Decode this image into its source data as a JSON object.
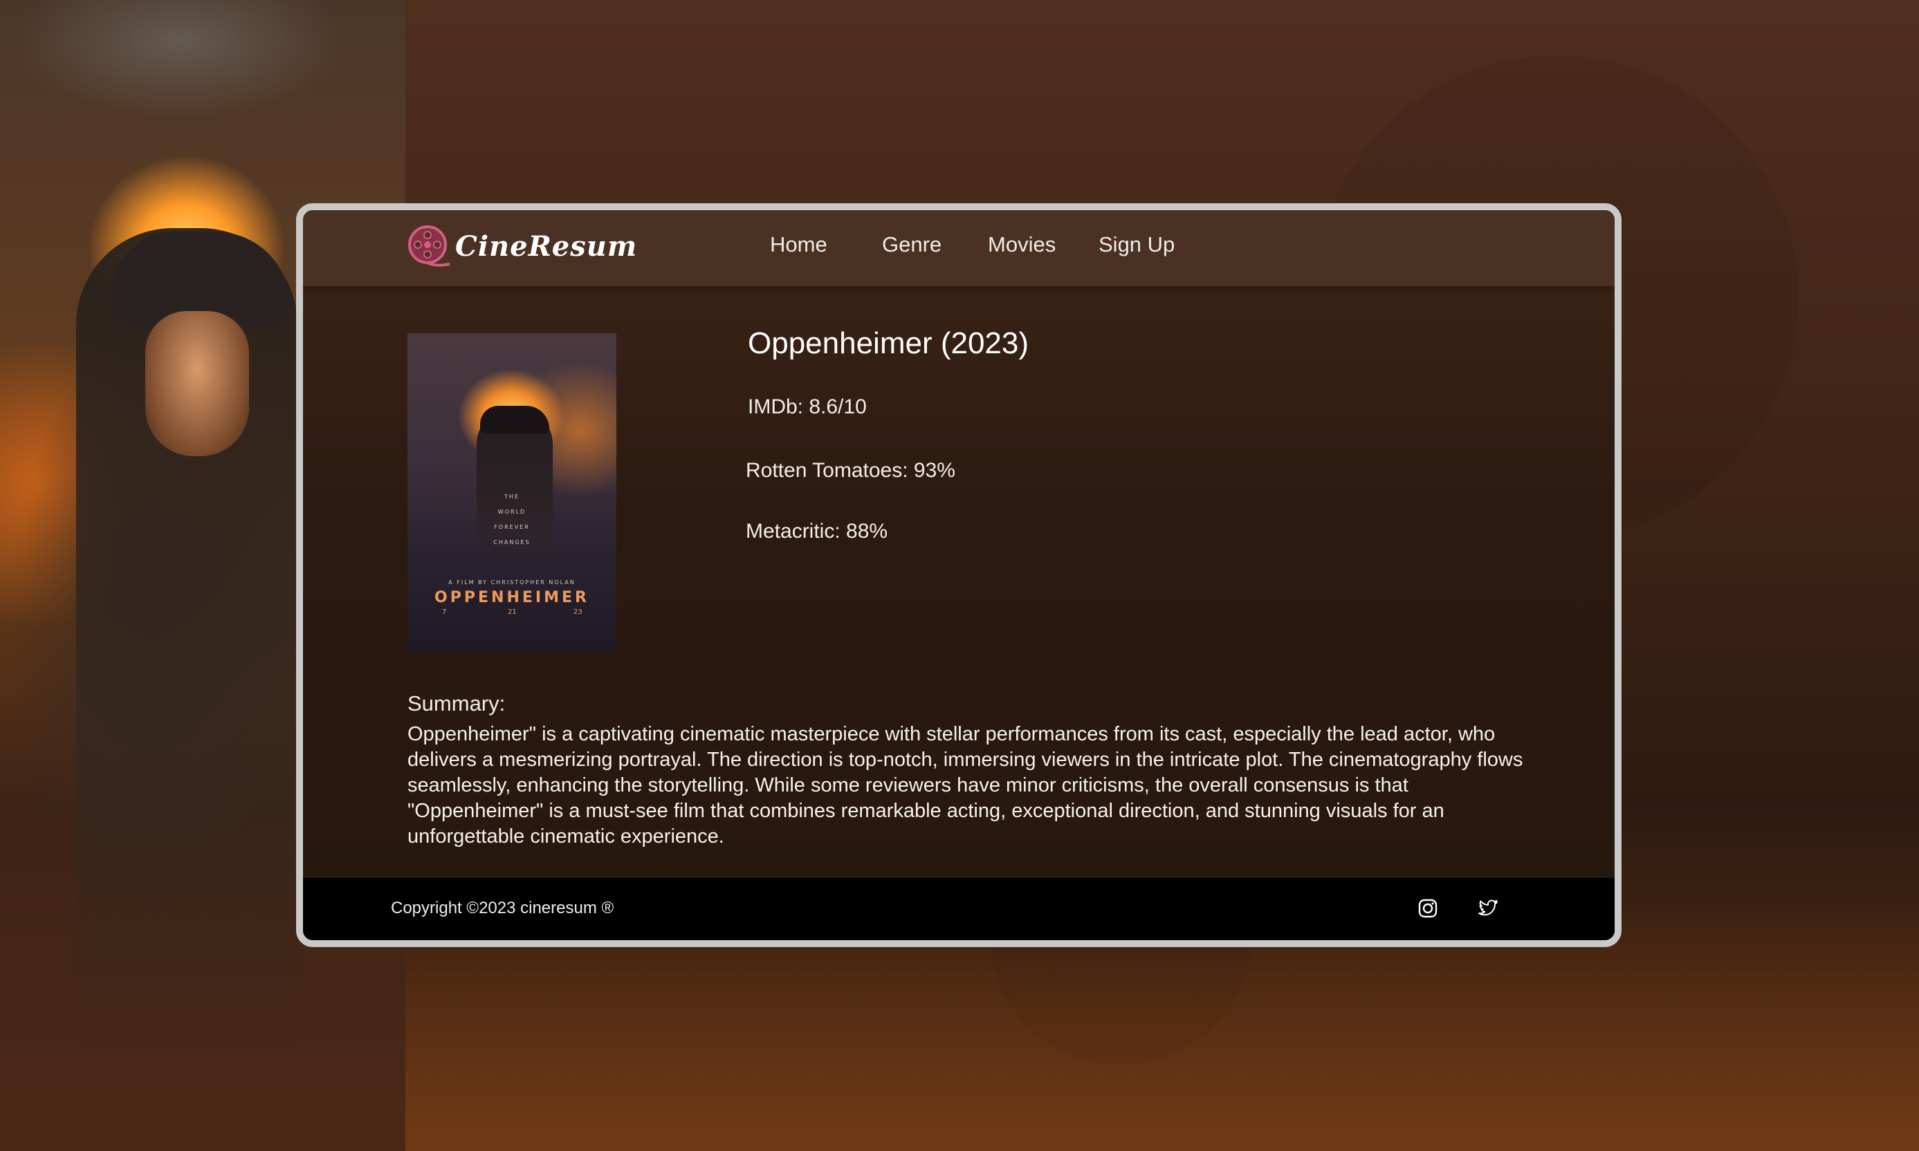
{
  "brand": {
    "name": "CineResum",
    "accent": "#c0506a"
  },
  "nav": {
    "items": [
      {
        "label": "Home"
      },
      {
        "label": "Genre"
      },
      {
        "label": "Movies"
      },
      {
        "label": "Sign Up"
      }
    ]
  },
  "poster": {
    "tagline_lines": [
      "THE",
      "WORLD",
      "FOREVER",
      "CHANGES"
    ],
    "credit": "A FILM BY CHRISTOPHER NOLAN",
    "title": "OPPENHEIMER",
    "date": {
      "month": "7",
      "day": "21",
      "year": "23"
    }
  },
  "movie": {
    "title": "Oppenheimer (2023)",
    "ratings": {
      "imdb": "IMDb: 8.6/10",
      "rotten_tomatoes": "Rotten Tomatoes: 93%",
      "metacritic": "Metacritic: 88%"
    },
    "summary_label": "Summary:",
    "summary": "Oppenheimer\" is a captivating cinematic masterpiece with stellar performances from its cast, especially the lead actor, who delivers a mesmerizing portrayal. The direction is top-notch, immersing viewers in the intricate plot. The cinematography flows seamlessly, enhancing the storytelling. While some reviewers have minor criticisms, the overall consensus is that \"Oppenheimer\" is a must-see film that combines remarkable acting, exceptional direction, and stunning visuals for an unforgettable cinematic experience."
  },
  "footer": {
    "copyright": "Copyright ©2023 cineresum ®",
    "social_icons": [
      "instagram-icon",
      "twitter-icon"
    ]
  }
}
